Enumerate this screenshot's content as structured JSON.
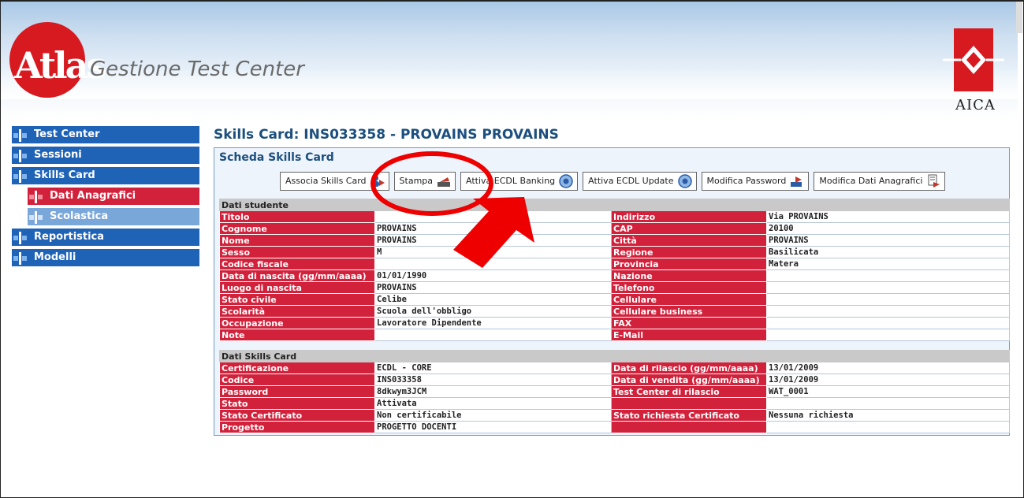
{
  "header": {
    "logo_text": "Atlas",
    "app_title": "Gestione Test Center",
    "aica_label": "AICA"
  },
  "sidebar": {
    "items": [
      {
        "label": "Test Center"
      },
      {
        "label": "Sessioni"
      },
      {
        "label": "Skills Card"
      },
      {
        "label": "Dati Anagrafici"
      },
      {
        "label": "Scolastica"
      },
      {
        "label": "Reportistica"
      },
      {
        "label": "Modelli"
      }
    ]
  },
  "page": {
    "title": "Skills Card: INS033358 - PROVAINS PROVAINS"
  },
  "card": {
    "title": "Scheda Skills Card",
    "buttons": [
      {
        "label": "Associa Skills Card"
      },
      {
        "label": "Stampa"
      },
      {
        "label": "Attiva ECDL Banking"
      },
      {
        "label": "Attiva ECDL Update"
      },
      {
        "label": "Modifica Password"
      },
      {
        "label": "Modifica Dati Anagrafici"
      }
    ]
  },
  "studente": {
    "section": "Dati studente",
    "rows": [
      [
        "Titolo",
        "",
        "Indirizzo",
        "Via PROVAINS"
      ],
      [
        "Cognome",
        "PROVAINS",
        "CAP",
        "20100"
      ],
      [
        "Nome",
        "PROVAINS",
        "Città",
        "PROVAINS"
      ],
      [
        "Sesso",
        "M",
        "Regione",
        "Basilicata"
      ],
      [
        "Codice fiscale",
        "",
        "Provincia",
        "Matera"
      ],
      [
        "Data di nascita (gg/mm/aaaa)",
        "01/01/1990",
        "Nazione",
        ""
      ],
      [
        "Luogo di nascita",
        "PROVAINS",
        "Telefono",
        ""
      ],
      [
        "Stato civile",
        "Celibe",
        "Cellulare",
        ""
      ],
      [
        "Scolarità",
        "Scuola dell'obbligo",
        "Cellulare business",
        ""
      ],
      [
        "Occupazione",
        "Lavoratore Dipendente",
        "FAX",
        ""
      ],
      [
        "Note",
        "",
        "E-Mail",
        ""
      ]
    ]
  },
  "skills": {
    "section": "Dati Skills Card",
    "rows": [
      [
        "Certificazione",
        "ECDL - CORE",
        "Data di rilascio (gg/mm/aaaa)",
        "13/01/2009"
      ],
      [
        "Codice",
        "INS033358",
        "Data di vendita (gg/mm/aaaa)",
        "13/01/2009"
      ],
      [
        "Password",
        "8dkwym3JCM",
        "Test Center di rilascio",
        "WAT_0001"
      ],
      [
        "Stato",
        "Attivata",
        "",
        ""
      ],
      [
        "Stato Certificato",
        "Non certificabile",
        "Stato richiesta Certificato",
        "Nessuna richiesta"
      ],
      [
        "Progetto",
        "PROGETTO DOCENTI",
        "",
        ""
      ]
    ]
  },
  "colors": {
    "nav_blue": "#1f63b7",
    "nav_active": "#d2213b",
    "label_red": "#d2213b",
    "title_blue": "#1c4f7f",
    "annotation_red": "#ee0000"
  }
}
